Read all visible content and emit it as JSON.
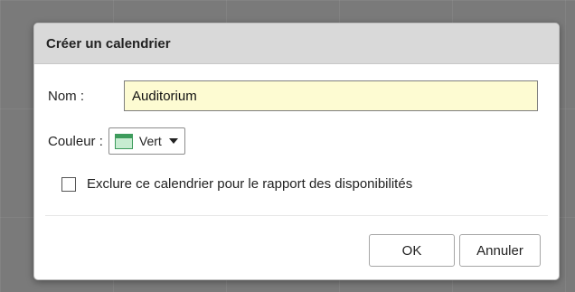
{
  "dialog": {
    "title": "Créer un calendrier",
    "name": {
      "label": "Nom :",
      "value": "Auditorium"
    },
    "color": {
      "label": "Couleur :",
      "value": "Vert",
      "icon": "color-swatch-icon",
      "swatch_color": "#3d9b5c"
    },
    "exclude": {
      "label": "Exclure ce calendrier pour le rapport des disponibilités",
      "checked": false
    },
    "buttons": {
      "ok": "OK",
      "cancel": "Annuler"
    }
  }
}
